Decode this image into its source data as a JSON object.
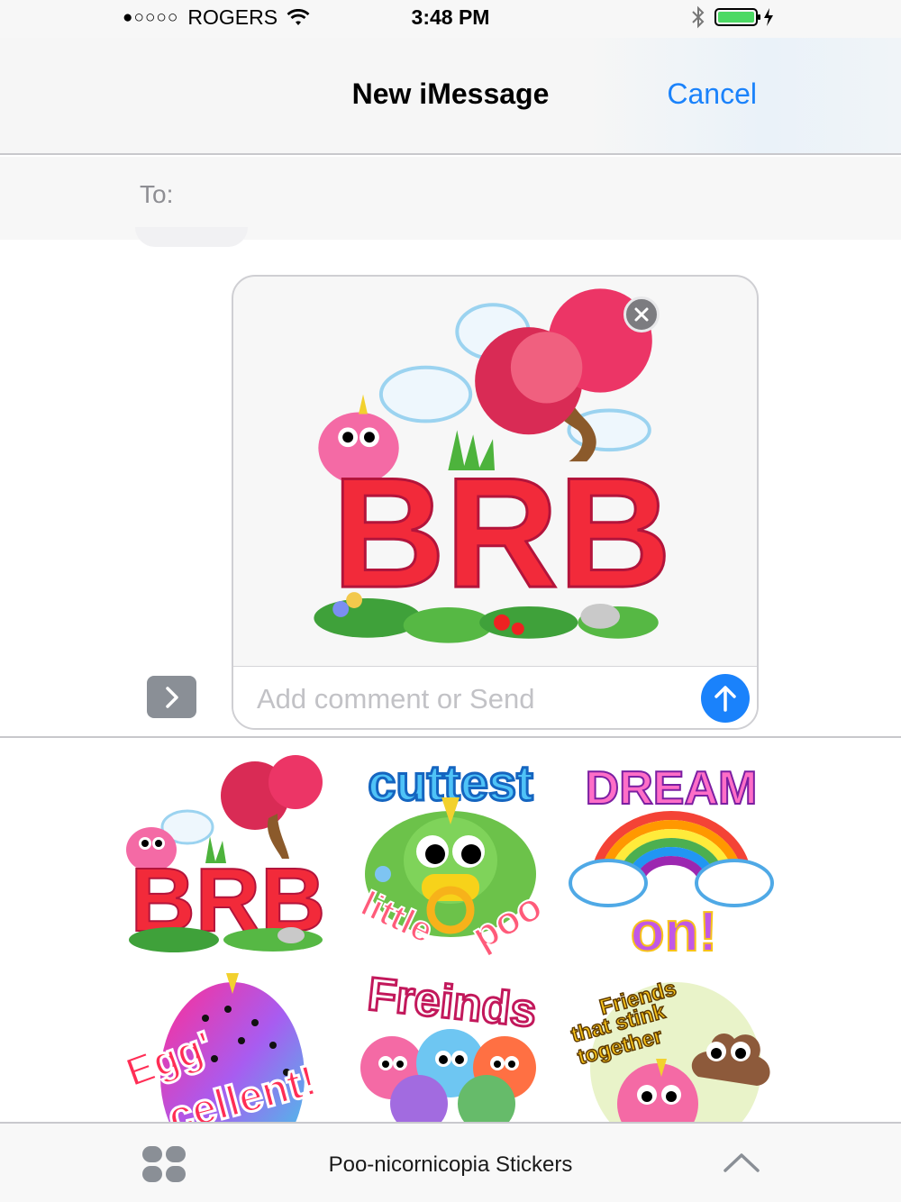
{
  "status_bar": {
    "signal": "●○○○○",
    "carrier": "ROGERS",
    "time": "3:48 PM",
    "icons": [
      "wifi-icon",
      "bluetooth-icon",
      "battery-charging-icon"
    ]
  },
  "nav": {
    "title": "New iMessage",
    "cancel_label": "Cancel"
  },
  "to_field": {
    "label": "To:"
  },
  "compose": {
    "sticker_text": "BRB",
    "placeholder": "Add comment or Send"
  },
  "stickers": [
    {
      "name": "brb",
      "text": "BRB"
    },
    {
      "name": "cuttest-little-poo",
      "text_top": "cuttest",
      "text_bottom": "little",
      "text_bottom2": "poo"
    },
    {
      "name": "dream-on",
      "text_top": "DREAM",
      "text_bottom": "on!"
    },
    {
      "name": "egg-cellent",
      "text_top": "Egg'",
      "text_bottom": "cellent!"
    },
    {
      "name": "freinds",
      "text": "Freinds"
    },
    {
      "name": "friends-that-stink-together",
      "line1": "Friends",
      "line2": "that stink",
      "line3": "together"
    }
  ],
  "drawer": {
    "title": "Poo-nicornicopia Stickers"
  },
  "colors": {
    "accent": "#1a82fb",
    "sticker_red": "#ee2233",
    "tree_pink": "#e8345c"
  }
}
